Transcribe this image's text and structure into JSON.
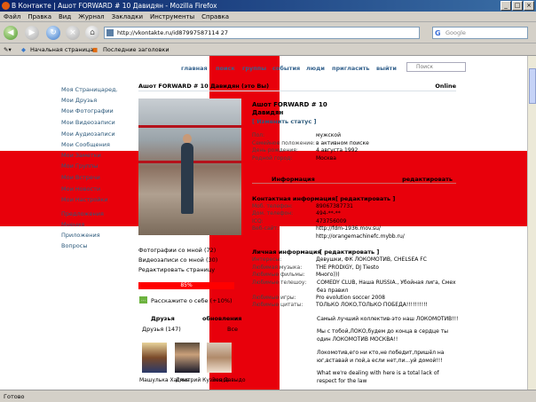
{
  "window": {
    "title": "В Контакте | Ашот FORWARD # 10 Давидян - Mozilla Firefox",
    "buttons": [
      "_",
      "□",
      "×"
    ]
  },
  "menu": [
    "Файл",
    "Правка",
    "Вид",
    "Журнал",
    "Закладки",
    "Инструменты",
    "Справка"
  ],
  "toolbar": {
    "url": "http://vkontakte.ru/id87997587114 27",
    "search_placeholder": "Google"
  },
  "bookmarks": [
    "Начальная страница",
    "Последние заголовки"
  ],
  "site_nav": {
    "links": [
      "главная",
      "поиск",
      "группы",
      "события",
      "люди",
      "пригласить",
      "выйти"
    ],
    "search_placeholder": "Поиск"
  },
  "left_nav": {
    "my_page": "Моя Страница",
    "edit": "ред.",
    "items": [
      "Мои Друзья",
      "Мои Фотографии",
      "Мои Видеозаписи",
      "Мои Аудиозаписи",
      "Мои Сообщения",
      "Мои Заметки",
      "Мои Группы",
      "Мои Встречи",
      "Мои Новости",
      "Мои Настройки"
    ],
    "extra": [
      "Предложения",
      "Мнения",
      "Приложения",
      "Вопросы"
    ]
  },
  "header": {
    "title": "Ашот FORWARD # 10 Давидян (это Вы)",
    "online": "Online"
  },
  "profile": {
    "name_line1": "Ашот FORWARD # 10",
    "name_line2": "Давидян",
    "status_link": "[ Изменить статус ]",
    "photo_links": [
      "Фотографии со мной (72)",
      "Видеозаписи со мной (30)",
      "Редактировать страницу"
    ],
    "rating": "85%",
    "rating_fraction": 0.85,
    "tell_about": "Расскажите о себе (+10%)",
    "friends_title": "Друзья",
    "friends_updates": "обновления",
    "friends_count": "Друзья (147)",
    "friends_all": "Все",
    "friends": [
      "Машулька Хасяна",
      "Дмитрий Кузнецов",
      "Зоя Давыдо"
    ]
  },
  "info": {
    "rows": [
      {
        "label": "Пол:",
        "value": "мужской"
      },
      {
        "label": "Семейное положение:",
        "value": "в активном поиске"
      },
      {
        "label": "День рождения:",
        "value": "4 августа 1992"
      },
      {
        "label": "Родной город:",
        "value": "Москва"
      }
    ],
    "section_title": "Информация",
    "edit": "редактировать"
  },
  "contact": {
    "title": "Контактная информация",
    "edit": "[ редактировать ]",
    "rows": [
      {
        "label": "Моб. телефон:",
        "value": "89067387731"
      },
      {
        "label": "Дом. телефон:",
        "value": "494-**-**"
      },
      {
        "label": "ICQ:",
        "value": "473756009"
      },
      {
        "label": "Веб-сайт:",
        "value": "http://fdm-1936.mov.su/"
      }
    ],
    "website2": "http://orangemachinefc.mybb.ru/"
  },
  "personal": {
    "title": "Личная информация",
    "edit": "[ редактировать ]",
    "rows": [
      {
        "label": "Интересы:",
        "value": "Девушки, ФК ЛОКОМОТИВ, CHELSEA FC"
      },
      {
        "label": "Любимая музыка:",
        "value": "THE PRODIGY, DJ Tiesto"
      },
      {
        "label": "Любимые фильмы:",
        "value": "Много)))"
      },
      {
        "label": "Любимые телешоу:",
        "value": "COMEDY CLUB, Наша RUSSIA., Убойная лига, Смех без правил"
      },
      {
        "label": "Любимые игры:",
        "value": "Pro evolution soccer 2008"
      },
      {
        "label": "Любимые цитаты:",
        "value": "ТОЛЬКО ЛОКО,ТОЛЬКО ПОБЕДА!!!!!!!!!!"
      }
    ],
    "paragraphs": [
      "Самый лучший коллектив-это наш ЛОКОМОТИВ!!!",
      "Мы с тобой,ЛОКО,будем до конца в сердце ты один ЛОКОМОТИВ МОСКВА!!",
      "Локомотив,его ни кто,не победит,пришёл на юг,вставай и пой,а если нет,пи...уй домой!!!",
      "What we're dealing with here is a total lack of respect for the law"
    ]
  },
  "statusbar": "Готово",
  "colors": {
    "flag_red": "#e8000b",
    "link": "#2b587a",
    "title_bar": "#0a246a"
  }
}
